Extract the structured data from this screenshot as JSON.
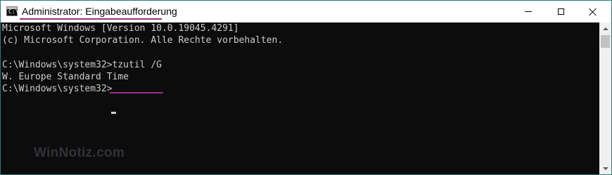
{
  "window": {
    "title": "Administrator: Eingabeaufforderung",
    "icon": "cmd-icon",
    "icon_glyph": "C:\\",
    "buttons": {
      "minimize": "minimize-icon",
      "maximize": "maximize-icon",
      "close": "close-icon"
    }
  },
  "console": {
    "lines": [
      "Microsoft Windows [Version 10.0.19045.4291]",
      "(c) Microsoft Corporation. Alle Rechte vorbehalten.",
      "C:\\Windows\\system32>tzutil /G",
      "W. Europe Standard Time",
      "C:\\Windows\\system32>"
    ]
  },
  "watermark": "WinNotiz.com",
  "colors": {
    "console_background": "#0c0c0c",
    "console_text": "#cccccc",
    "highlight_underline": "#9b2c8f",
    "titlebar": "#ffffff"
  }
}
